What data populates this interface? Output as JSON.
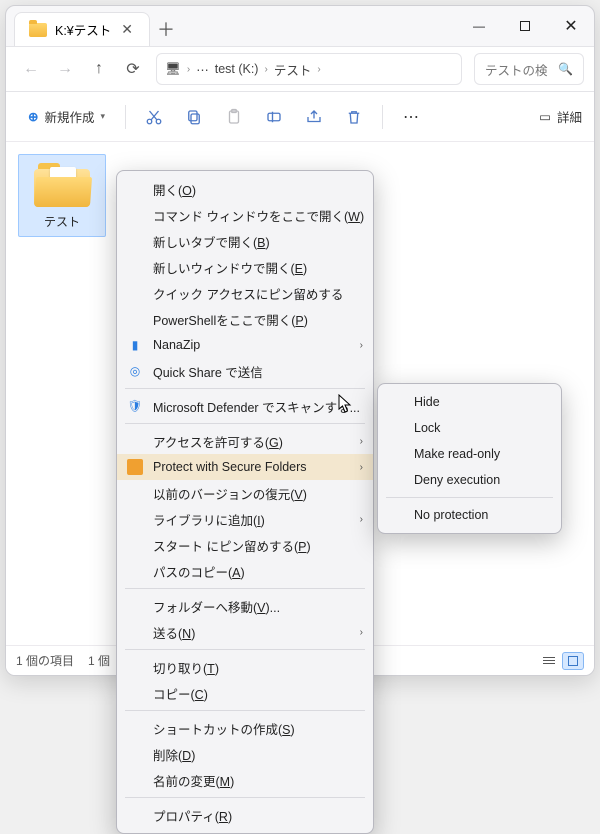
{
  "titlebar": {
    "tab_title": "K:¥テスト"
  },
  "breadcrumb": {
    "root": "test (K:)",
    "folder": "テスト",
    "ellipsis": "⋯"
  },
  "search": {
    "placeholder": "テストの検",
    "icon": "🔍"
  },
  "toolbar": {
    "new_label": "新規作成",
    "details_label": "詳細"
  },
  "item": {
    "name": "テスト"
  },
  "status": {
    "count": "1 個の項目",
    "selected": "1 個"
  },
  "context_menu": {
    "open": "開く(O)",
    "cmd_here": "コマンド ウィンドウをここで開く(W)",
    "new_tab": "新しいタブで開く(B)",
    "new_window": "新しいウィンドウで開く(E)",
    "pin_quick": "クイック アクセスにピン留めする",
    "powershell": "PowerShellをここで開く(P)",
    "nanazip": "NanaZip",
    "quickshare": "Quick Share で送信",
    "defender": "Microsoft Defender でスキャンする...",
    "grant_access": "アクセスを許可する(G)",
    "protect_secure": "Protect with Secure Folders",
    "prev_versions": "以前のバージョンの復元(V)",
    "add_library": "ライブラリに追加(I)",
    "pin_start": "スタート にピン留めする(P)",
    "copy_path": "パスのコピー(A)",
    "move_to_folder": "フォルダーへ移動(V)...",
    "send_to": "送る(N)",
    "cut": "切り取り(T)",
    "copy": "コピー(C)",
    "shortcut": "ショートカットの作成(S)",
    "delete": "削除(D)",
    "rename": "名前の変更(M)",
    "properties": "プロパティ(R)"
  },
  "submenu": {
    "hide": "Hide",
    "lock": "Lock",
    "readonly": "Make read-only",
    "deny": "Deny execution",
    "noprotect": "No protection"
  }
}
